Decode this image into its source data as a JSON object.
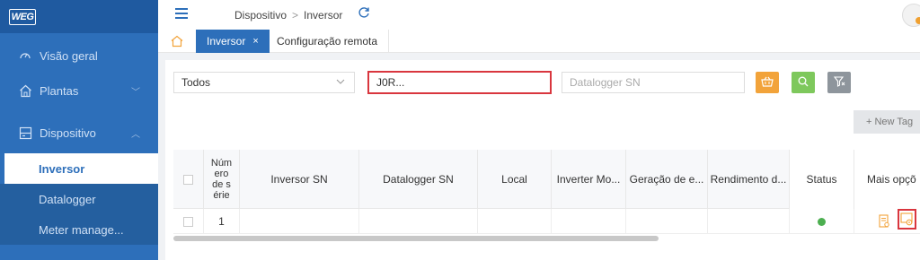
{
  "sidebar": {
    "logo": "WEG",
    "items": [
      {
        "label": "Visão geral",
        "icon": "gauge-icon"
      },
      {
        "label": "Plantas",
        "icon": "home-icon",
        "chevron": "﹀"
      },
      {
        "label": "Dispositivo",
        "icon": "device-icon",
        "chevron": "︿"
      }
    ],
    "subitems": [
      {
        "label": "Inversor",
        "active": true
      },
      {
        "label": "Datalogger",
        "active": false
      },
      {
        "label": "Meter manage...",
        "active": false
      }
    ]
  },
  "topbar": {
    "breadcrumb": [
      "Dispositivo",
      "Inversor"
    ],
    "breadcrumb_sep": ">"
  },
  "tabs": [
    {
      "label": "Inversor",
      "close": "×",
      "active": true
    },
    {
      "label": "Configuração remota",
      "active": false
    }
  ],
  "filters": {
    "select_value": "Todos",
    "inverter_sn_value": "J0R...",
    "datalogger_placeholder": "Datalogger SN"
  },
  "new_tag_label": "+ New Tag",
  "table": {
    "headers": [
      "Núm\nero\nde s\nérie",
      "Inversor SN",
      "Datalogger SN",
      "Local",
      "Inverter Mo...",
      "Geração de e...",
      "Rendimento d...",
      "Status",
      "Mais opçõ"
    ],
    "rows": [
      {
        "num": "1",
        "inverter_sn": "",
        "datalogger_sn": "",
        "local": "",
        "model": "",
        "generation": "",
        "yield": "",
        "status": "online"
      }
    ]
  },
  "colors": {
    "primary": "#2d6fba",
    "highlight": "#d9363e",
    "status_ok": "#4caf50"
  }
}
